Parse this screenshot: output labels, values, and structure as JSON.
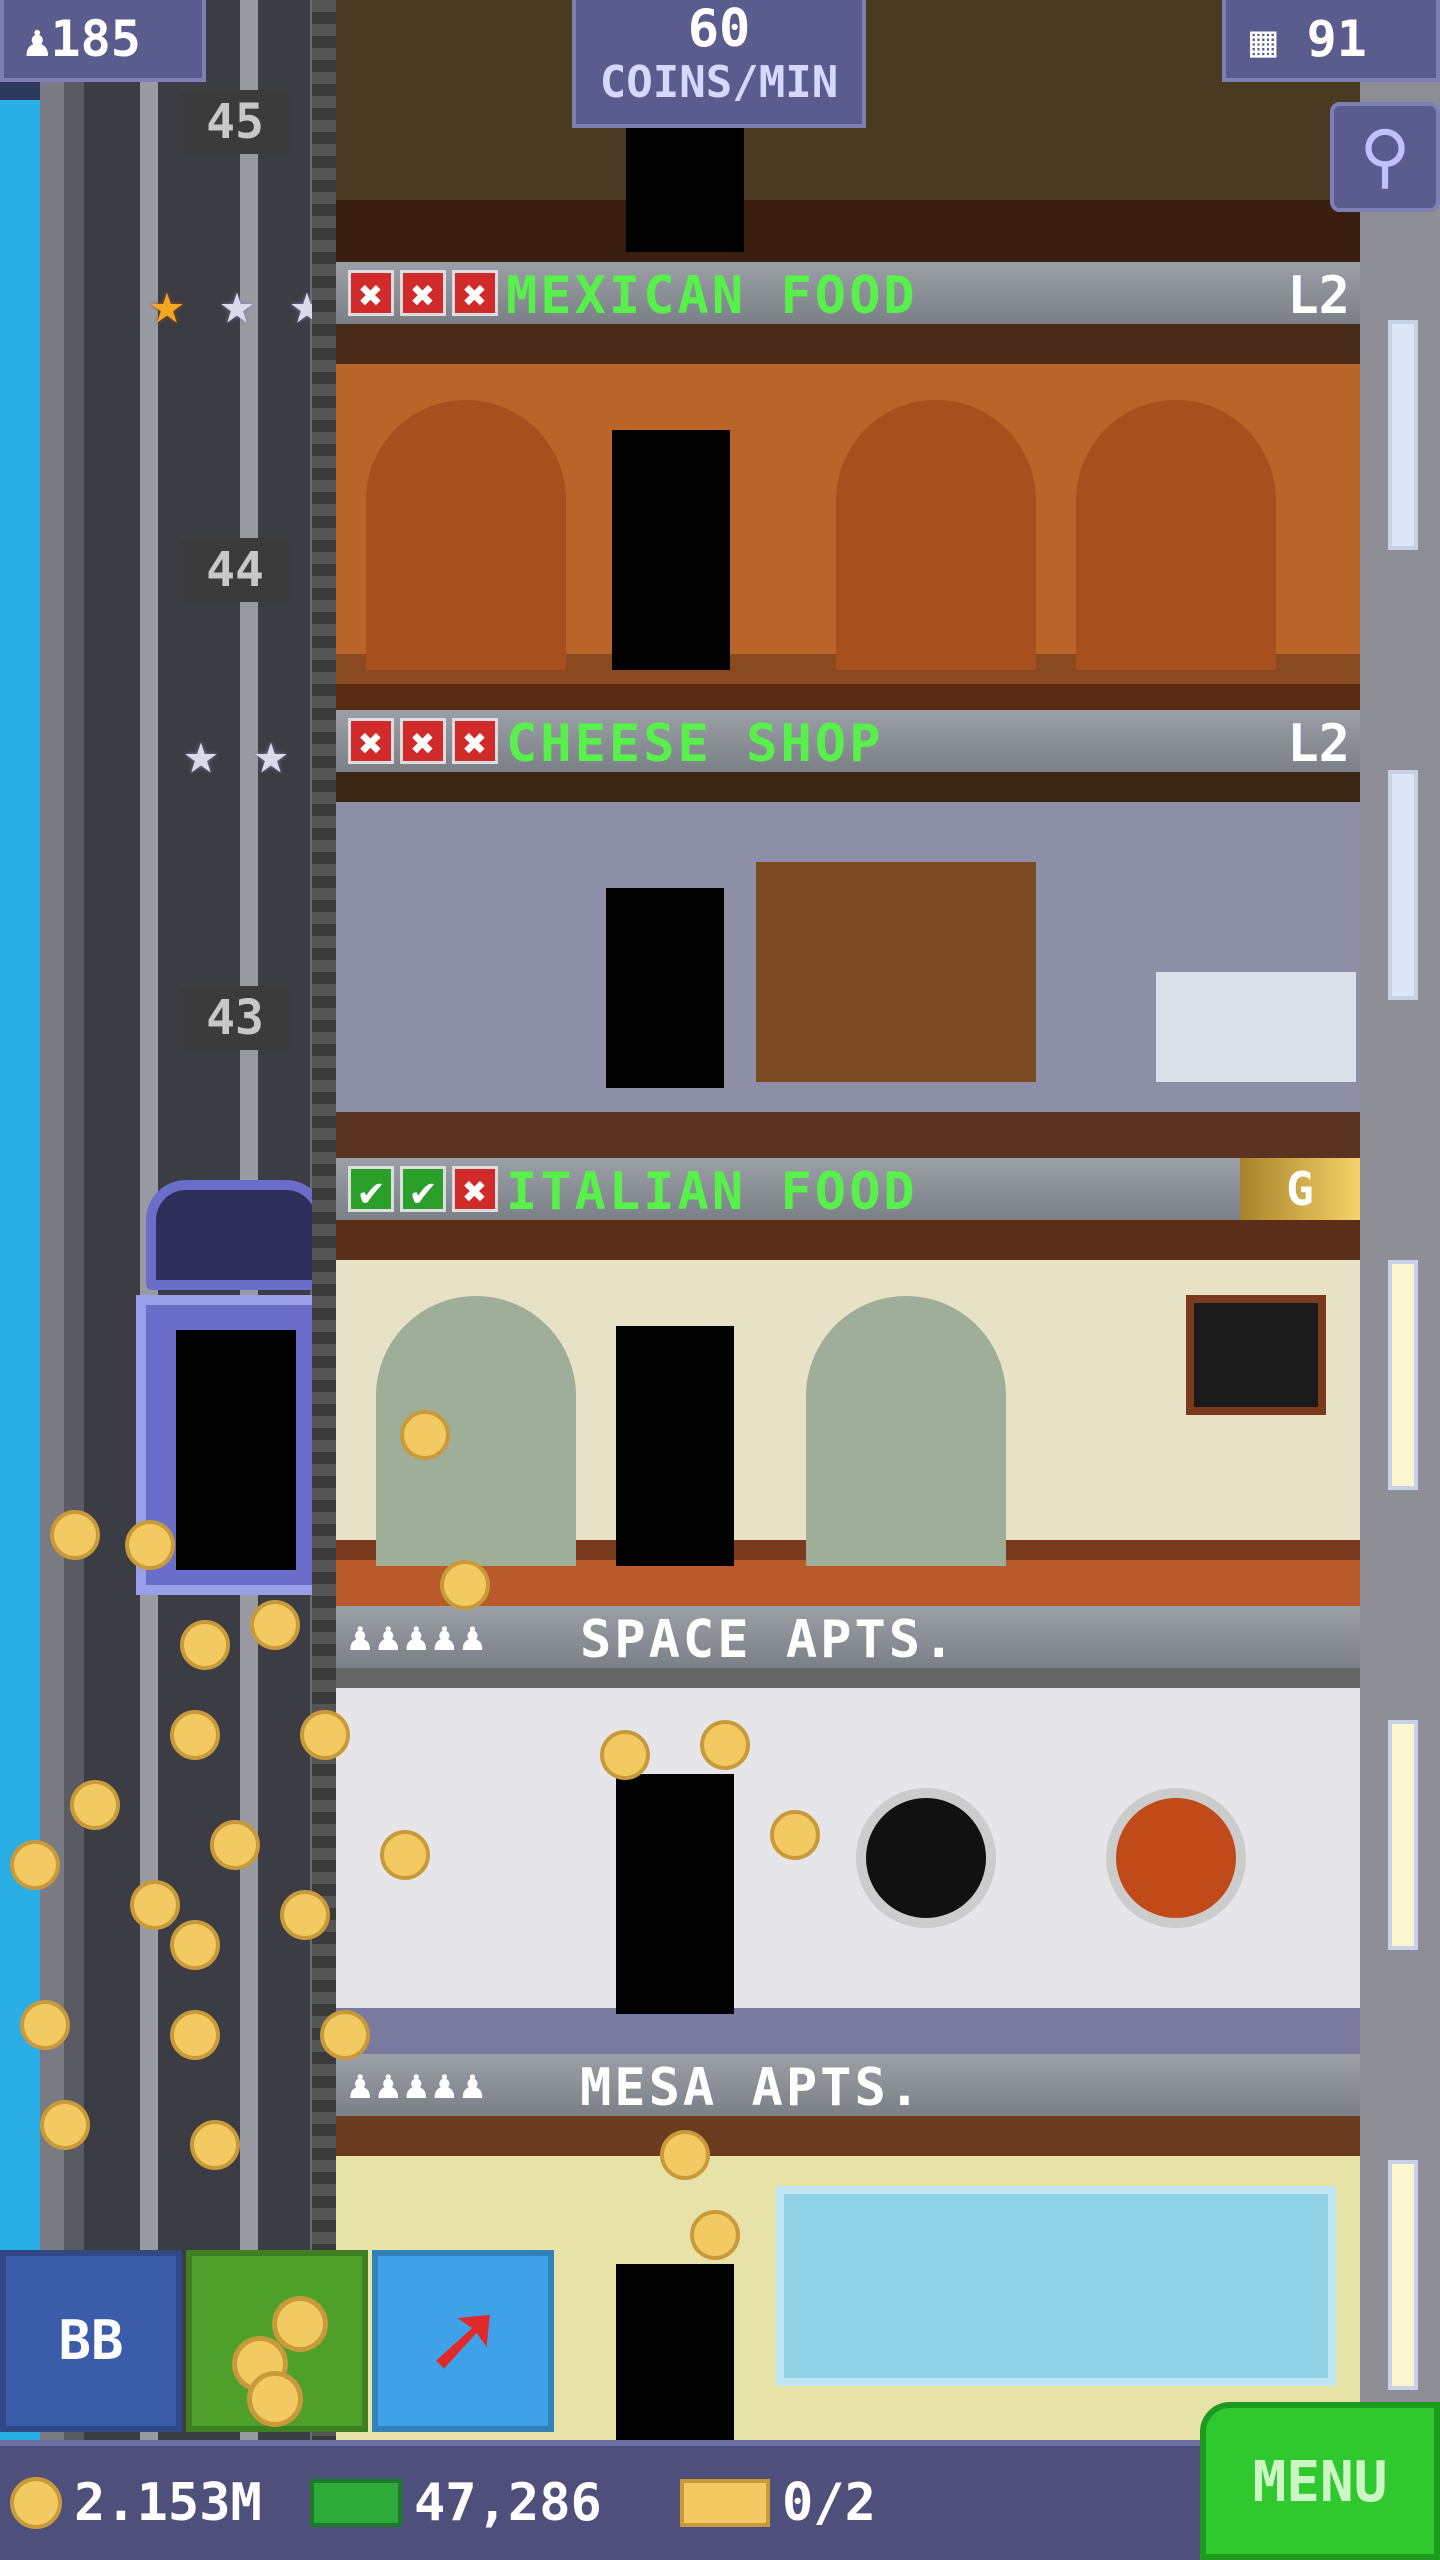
{
  "hud": {
    "population": "185",
    "coins_rate_value": "60",
    "coins_rate_unit": "COINS/MIN",
    "floors_count": "91"
  },
  "floors": [
    {
      "number": "45",
      "name": "MEXICAN FOOD",
      "level": "L2",
      "stars_gold": 1,
      "stars_total": 3,
      "checks": [
        "x",
        "x",
        "x"
      ]
    },
    {
      "number": "44",
      "name": "CHEESE SHOP",
      "level": "L2",
      "stars_gold": 0,
      "stars_total": 2,
      "checks": [
        "x",
        "x",
        "x"
      ]
    },
    {
      "number": "43",
      "name": "ITALIAN FOOD",
      "level": "G",
      "checks": [
        "ok",
        "ok",
        "x"
      ]
    },
    {
      "name": "SPACE APTS.",
      "residents": "♟♟♟♟♟"
    },
    {
      "name": "MESA APTS.",
      "residents": "♟♟♟♟♟"
    }
  ],
  "actions": {
    "bb_label": "BB",
    "coins_icon": "coins-icon",
    "rocket_icon": "rocket-icon"
  },
  "bottom": {
    "coins": "2.153M",
    "bux": "47,286",
    "golden_tickets": "0/2",
    "menu_label": "MENU"
  },
  "colors": {
    "hud_panel": "#5b5c8e",
    "floor_title": "#58f04a",
    "menu_button": "#2fc82f"
  }
}
